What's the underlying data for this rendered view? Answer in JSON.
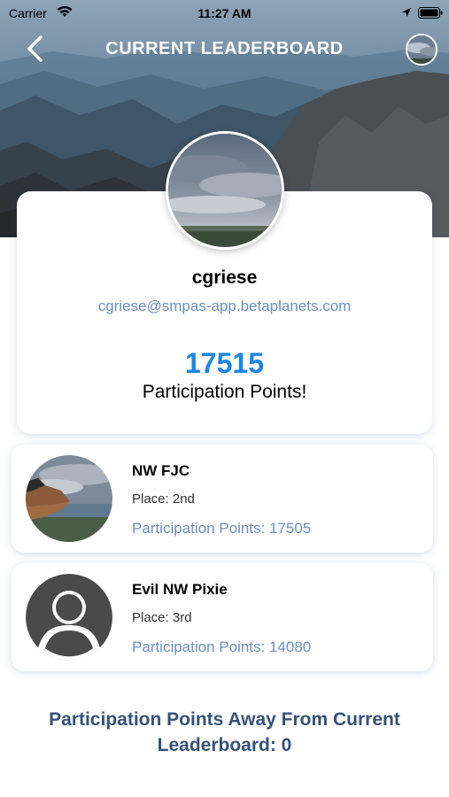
{
  "status_bar": {
    "carrier": "Carrier",
    "time": "11:27 AM"
  },
  "nav": {
    "title": "CURRENT LEADERBOARD",
    "back_icon": "chevron-left-icon",
    "avatar_icon": "user-avatar"
  },
  "profile": {
    "username": "cgriese",
    "email": "cgriese@smpas-app.betaplanets.com",
    "points": "17515",
    "points_label": "Participation Points!"
  },
  "leaderboard": [
    {
      "name": "NW FJC",
      "place": "Place: 2nd",
      "points": "Participation Points: 17505"
    },
    {
      "name": "Evil NW Pixie",
      "place": "Place: 3rd",
      "points": "Participation Points: 14080"
    }
  ],
  "footer": {
    "text": "Participation Points Away From Current Leaderboard: 0"
  },
  "colors": {
    "accent_blue": "#1a86e8",
    "link_blue": "#6b8fc6",
    "footer_navy": "#34527a"
  }
}
